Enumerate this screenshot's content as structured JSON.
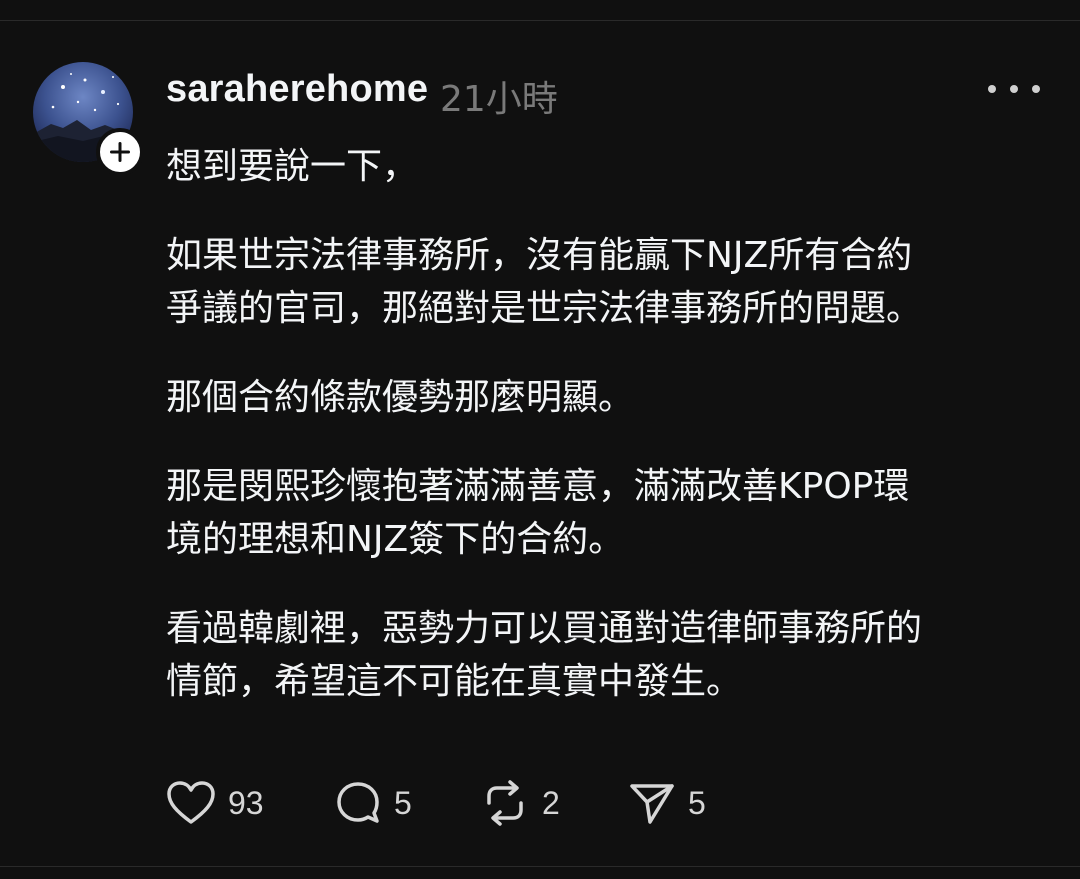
{
  "post": {
    "username": "saraherehome",
    "timestamp": "21小時",
    "paragraphs": [
      "想到要說一下，",
      "如果世宗法律事務所，沒有能贏下NJZ所有合約\n爭議的官司，那絕對是世宗法律事務所的問題。",
      "那個合約條款優勢那麼明顯。",
      "那是閔熙珍懷抱著滿滿善意，滿滿改善KPOP環\n境的理想和NJZ簽下的合約。",
      "看過韓劇裡，惡勢力可以買通對造律師事務所的\n情節，希望這不可能在真實中發生。"
    ]
  },
  "actions": {
    "likes": "93",
    "replies": "5",
    "reposts": "2",
    "shares": "5"
  },
  "icons": {
    "avatar": "starry-night-avatar",
    "follow": "plus-icon",
    "more": "ellipsis-icon",
    "like": "heart-icon",
    "reply": "comment-icon",
    "repost": "repost-icon",
    "share": "send-icon"
  },
  "colors": {
    "background": "#101010",
    "text": "#f3f5f7",
    "muted": "#7a7a7a"
  }
}
